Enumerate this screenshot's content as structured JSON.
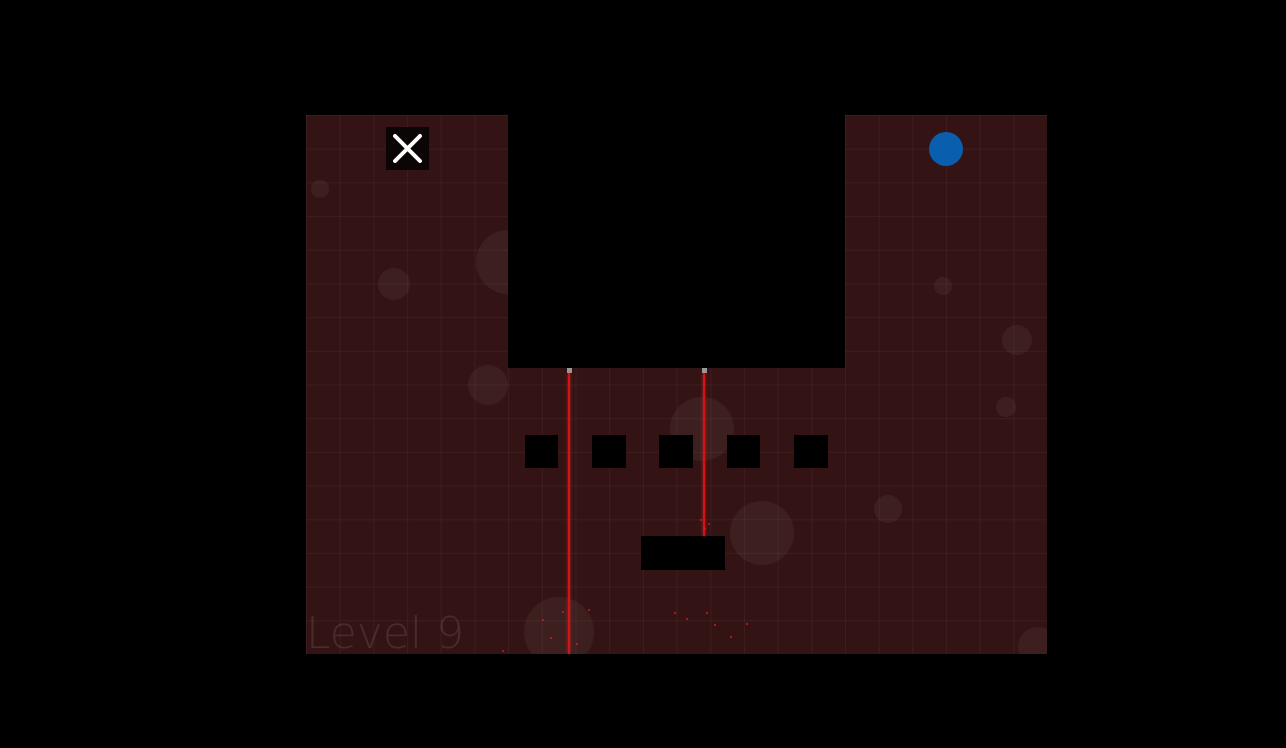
{
  "level": {
    "label": "Level 9"
  },
  "exit_button": {
    "icon": "close-icon",
    "color": "#ffffff",
    "background": "#0c0506"
  },
  "player": {
    "color": "#0a5eae"
  },
  "colors": {
    "board": "#341314",
    "laser": "#d41414",
    "wall": "#000000"
  }
}
